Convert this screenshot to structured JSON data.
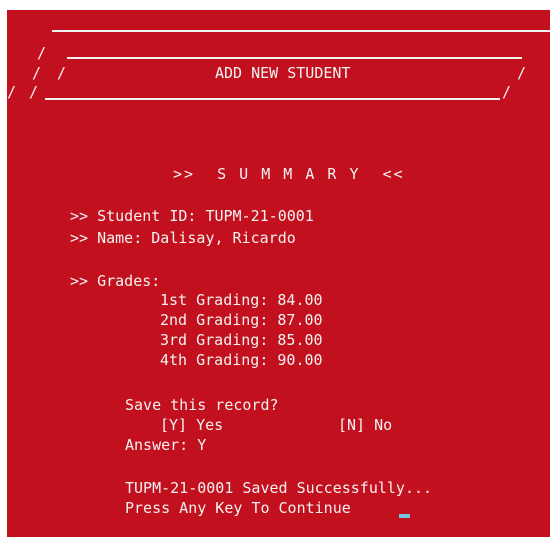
{
  "banner": {
    "top_rule": "    ______________________________________________________",
    "row_1": "   /   ________________________________________________/",
    "row_2": "  / /               ADD NEW STUDENT                  /",
    "row_3": " / /________________________________________________/",
    "title": "ADD NEW STUDENT"
  },
  "summary": {
    "heading": ">>  S U M M A R Y  <<"
  },
  "student": {
    "id_line": ">> Student ID: TUPM-21-0001",
    "name_line": ">> Name: Dalisay, Ricardo"
  },
  "grades": {
    "label": ">> Grades:",
    "items": [
      "1st Grading: 84.00",
      "2nd Grading: 87.00",
      "3rd Grading: 85.00",
      "4th Grading: 90.00"
    ]
  },
  "prompt": {
    "question": "Save this record?",
    "yes_option": "[Y] Yes",
    "no_option": "[N] No",
    "answer": "Answer: Y"
  },
  "status": {
    "saved_message": "TUPM-21-0001 Saved Successfully...",
    "continue_message": "Press Any Key To Continue"
  },
  "colors": {
    "background": "#c3101e",
    "text": "#f2f2f2",
    "cursor": "#6fc7de"
  }
}
